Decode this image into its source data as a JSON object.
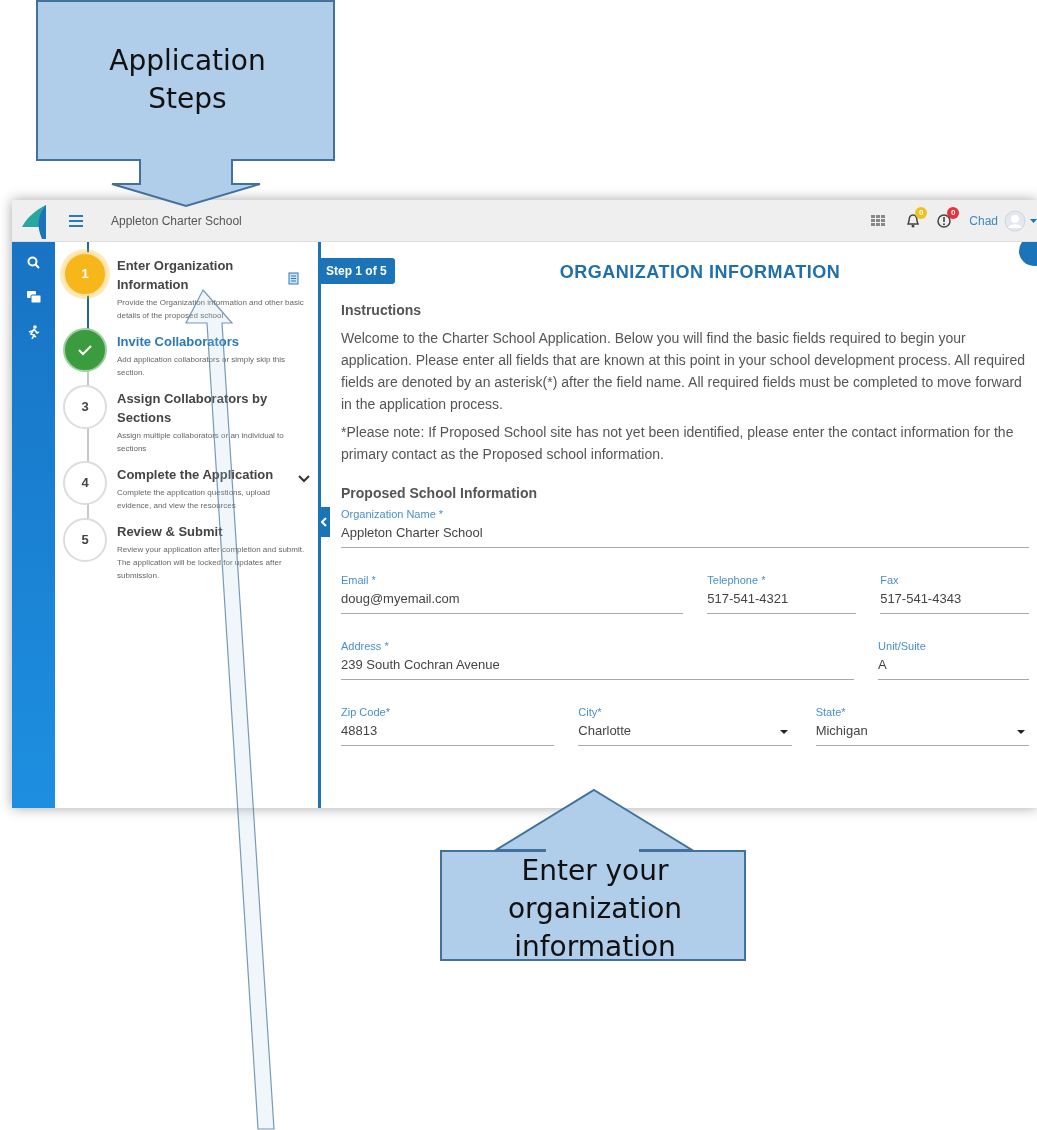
{
  "header": {
    "app_title": "Appleton Charter School",
    "indicators": [
      {
        "kind": "bell",
        "count": "0",
        "color": "#f2c21b"
      },
      {
        "kind": "alert",
        "count": "0",
        "color": "#e8323a"
      }
    ],
    "user": "Chad"
  },
  "rail": [
    {
      "kind": "search"
    },
    {
      "kind": "cards"
    },
    {
      "kind": "runner"
    }
  ],
  "steps": [
    {
      "number": "1",
      "title": "Enter Organization Information",
      "description": "Provide the Organization information and other basic details of the proposed school",
      "selected": true,
      "completed": false,
      "attachment": true,
      "expandable": false
    },
    {
      "title": "Invite Collaborators",
      "description": "Add application collaborators or simply skip this section.",
      "selected": false,
      "completed": true,
      "attachment": false,
      "expandable": false
    },
    {
      "number": "3",
      "title": "Assign Collaborators by Sections",
      "description": "Assign multiple collaborators or an individual to sections",
      "selected": false,
      "completed": false,
      "attachment": false,
      "expandable": false
    },
    {
      "number": "4",
      "title": "Complete the Application",
      "description": "Complete the application questions, upload evidence, and view the resources",
      "selected": false,
      "completed": false,
      "attachment": false,
      "expandable": true
    },
    {
      "number": "5",
      "title": "Review & Submit",
      "description": "Review your application after completion and submit. The application will be locked for updates after submission.",
      "selected": false,
      "completed": false,
      "attachment": false,
      "expandable": false
    }
  ],
  "main": {
    "step_badge": "Step 1 of 5",
    "title": "ORGANIZATION INFORMATION",
    "instructions_heading": "Instructions",
    "paragraphs": [
      "Welcome to the Charter School Application. Below you will find the basic fields required to begin your application. Please enter all fields that are known at this point in your school development process. All required fields are denoted by an asterisk(*) after the field name. All required fields must be completed to move forward in the application process.",
      "*Please note: If Proposed School site has not yet been identified, please enter the contact information for the primary contact as the Proposed school information."
    ],
    "section_heading": "Proposed School Information",
    "field_rows": [
      [
        {
          "label": "Organization Name *",
          "value": "Appleton Charter School",
          "kind": "text"
        }
      ],
      [
        {
          "label": "Email *",
          "value": "doug@myemail.com",
          "kind": "text"
        },
        {
          "label": "Telephone *",
          "value": "517-541-4321",
          "kind": "text"
        },
        {
          "label": "Fax",
          "value": "517-541-4343",
          "kind": "text"
        }
      ],
      [
        {
          "label": "Address *",
          "value": "239 South Cochran Avenue",
          "kind": "text"
        },
        {
          "label": "Unit/Suite",
          "value": "A",
          "kind": "text"
        }
      ],
      [
        {
          "label": "Zip Code*",
          "value": "48813",
          "kind": "text"
        },
        {
          "label": "City*",
          "value": "Charlotte",
          "kind": "select"
        },
        {
          "label": "State*",
          "value": "Michigan",
          "kind": "select"
        }
      ]
    ]
  },
  "annotations": [
    {
      "kind": "callout-down",
      "text": "Application Steps"
    },
    {
      "kind": "callout-up",
      "text": "Enter your organization information"
    },
    {
      "kind": "arrow"
    }
  ]
}
